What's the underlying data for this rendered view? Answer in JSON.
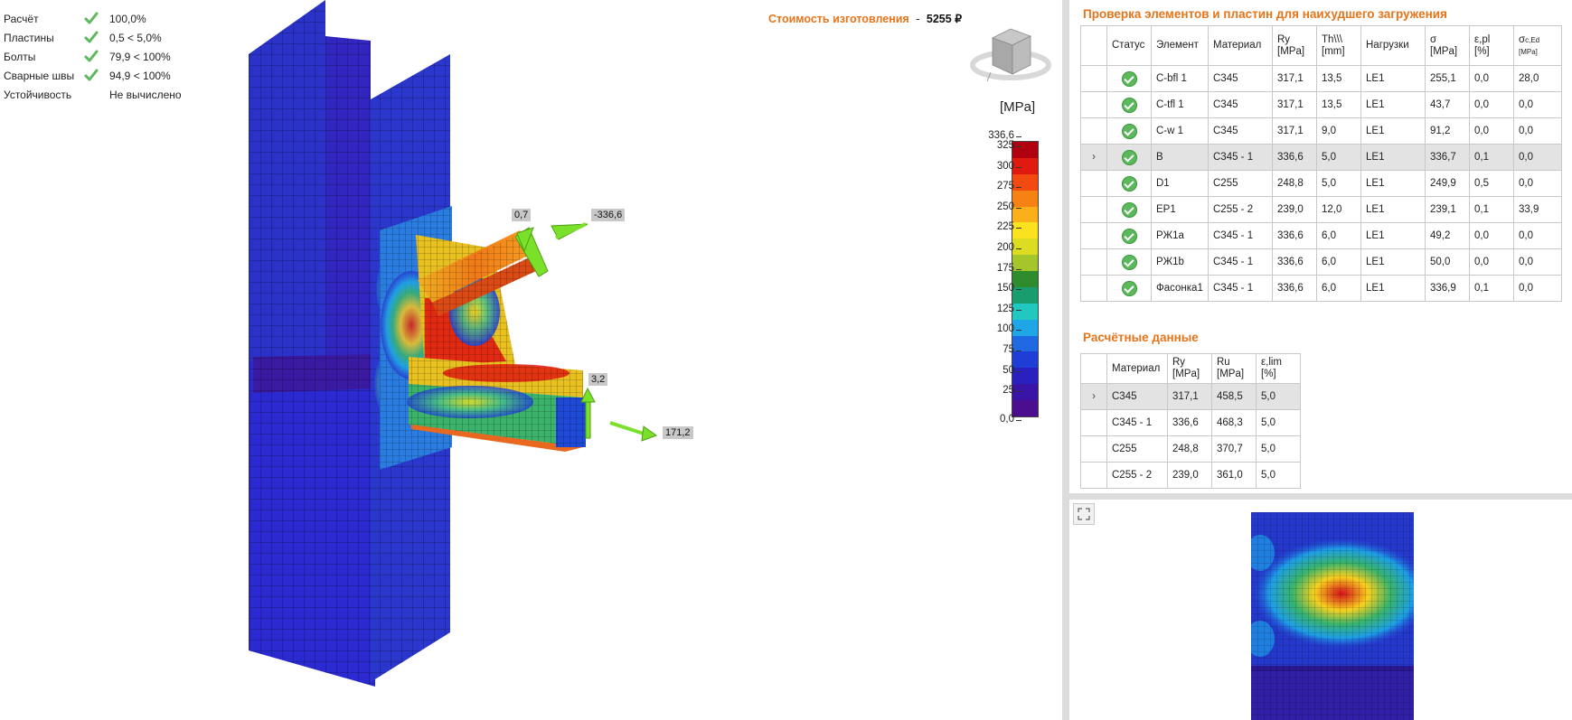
{
  "summary": [
    {
      "label": "Расчёт",
      "value": "100,0%",
      "ok": true
    },
    {
      "label": "Пластины",
      "value": "0,5 < 5,0%",
      "ok": true
    },
    {
      "label": "Болты",
      "value": "79,9 < 100%",
      "ok": true
    },
    {
      "label": "Сварные швы",
      "value": "94,9 < 100%",
      "ok": true
    },
    {
      "label": "Устойчивость",
      "value": "Не вычислено",
      "ok": false
    }
  ],
  "cost": {
    "label": "Стоимость изготовления",
    "separator": "-",
    "value": "5255 ₽"
  },
  "legend": {
    "unit": "[MPa]",
    "max_label": "336,6",
    "min_label": "0,0",
    "ticks": [
      "325",
      "300",
      "275",
      "250",
      "225",
      "200",
      "175",
      "150",
      "125",
      "100",
      "75",
      "50",
      "25"
    ],
    "colors": [
      "#b0000f",
      "#e01a0f",
      "#f24a10",
      "#f78214",
      "#fbb01a",
      "#fbe21f",
      "#dcdc22",
      "#a4c62a",
      "#2e8b2e",
      "#1a9d6e",
      "#20c8c0",
      "#1ea6e6",
      "#1f6ae2",
      "#1e3ed6",
      "#2a20c0",
      "#3a14a6",
      "#4a0e8e"
    ]
  },
  "forces": [
    {
      "value": "0,7"
    },
    {
      "value": "-336,6"
    },
    {
      "value": "3,2"
    },
    {
      "value": "171,2"
    }
  ],
  "check_table": {
    "title": "Проверка элементов и пластин для наихудшего загружения",
    "headers": {
      "status": "Статус",
      "element": "Элемент",
      "material": "Материал",
      "ry": "Ry",
      "ry_unit": "[MPa]",
      "th": "Th\\\\\\",
      "th_unit": "[mm]",
      "loads": "Нагрузки",
      "sigma": "σ",
      "sigma_unit": "[MPa]",
      "epl": "ε,pl",
      "epl_unit": "[%]",
      "sced": "σ",
      "sced_sub": "c,Ed",
      "sced_unit": "[MPa]"
    },
    "rows": [
      {
        "element": "C-bfl 1",
        "material": "C345",
        "ry": "317,1",
        "th": "13,5",
        "load": "LE1",
        "sigma": "255,1",
        "epl": "0,0",
        "sced": "28,0",
        "selected": false
      },
      {
        "element": "C-tfl 1",
        "material": "C345",
        "ry": "317,1",
        "th": "13,5",
        "load": "LE1",
        "sigma": "43,7",
        "epl": "0,0",
        "sced": "0,0",
        "selected": false
      },
      {
        "element": "C-w 1",
        "material": "C345",
        "ry": "317,1",
        "th": "9,0",
        "load": "LE1",
        "sigma": "91,2",
        "epl": "0,0",
        "sced": "0,0",
        "selected": false
      },
      {
        "element": "B",
        "material": "C345 - 1",
        "ry": "336,6",
        "th": "5,0",
        "load": "LE1",
        "sigma": "336,7",
        "epl": "0,1",
        "sced": "0,0",
        "selected": true
      },
      {
        "element": "D1",
        "material": "C255",
        "ry": "248,8",
        "th": "5,0",
        "load": "LE1",
        "sigma": "249,9",
        "epl": "0,5",
        "sced": "0,0",
        "selected": false
      },
      {
        "element": "EP1",
        "material": "C255 - 2",
        "ry": "239,0",
        "th": "12,0",
        "load": "LE1",
        "sigma": "239,1",
        "epl": "0,1",
        "sced": "33,9",
        "selected": false
      },
      {
        "element": "РЖ1a",
        "material": "C345 - 1",
        "ry": "336,6",
        "th": "6,0",
        "load": "LE1",
        "sigma": "49,2",
        "epl": "0,0",
        "sced": "0,0",
        "selected": false
      },
      {
        "element": "РЖ1b",
        "material": "C345 - 1",
        "ry": "336,6",
        "th": "6,0",
        "load": "LE1",
        "sigma": "50,0",
        "epl": "0,0",
        "sced": "0,0",
        "selected": false
      },
      {
        "element": "Фасонка1",
        "material": "C345 - 1",
        "ry": "336,6",
        "th": "6,0",
        "load": "LE1",
        "sigma": "336,9",
        "epl": "0,1",
        "sced": "0,0",
        "selected": false
      }
    ]
  },
  "design_table": {
    "title": "Расчётные данные",
    "headers": {
      "material": "Материал",
      "ry": "Ry",
      "ry_unit": "[MPa]",
      "ru": "Ru",
      "ru_unit": "[MPa]",
      "elim": "ε,lim",
      "elim_unit": "[%]"
    },
    "rows": [
      {
        "material": "C345",
        "ry": "317,1",
        "ru": "458,5",
        "elim": "5,0",
        "selected": true
      },
      {
        "material": "C345 - 1",
        "ry": "336,6",
        "ru": "468,3",
        "elim": "5,0",
        "selected": false
      },
      {
        "material": "C255",
        "ry": "248,8",
        "ru": "370,7",
        "elim": "5,0",
        "selected": false
      },
      {
        "material": "C255 - 2",
        "ry": "239,0",
        "ru": "361,0",
        "elim": "5,0",
        "selected": false
      }
    ]
  }
}
